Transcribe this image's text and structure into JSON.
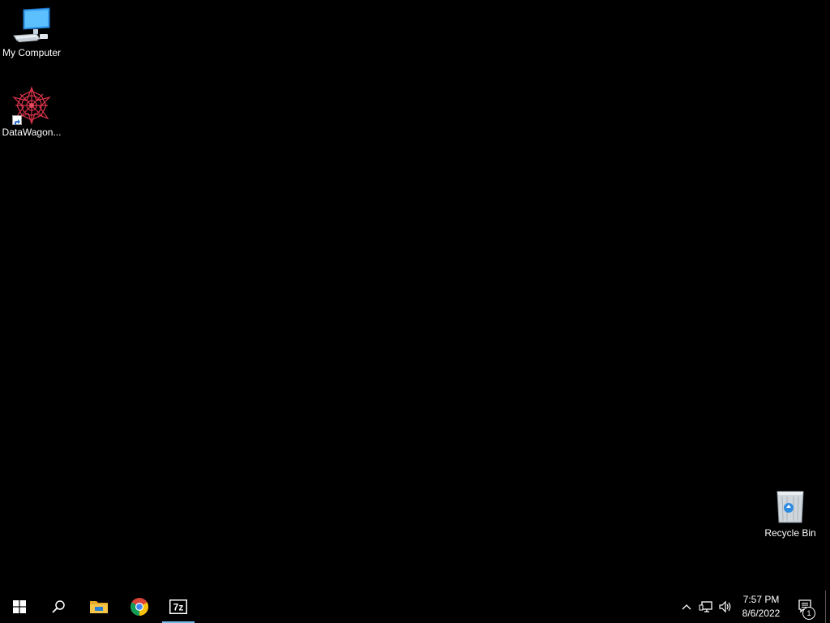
{
  "desktop": {
    "icons": [
      {
        "label": "My Computer",
        "icon": "computer-icon"
      },
      {
        "label": "DataWagon...",
        "icon": "datawagon-icon"
      },
      {
        "label": "Recycle Bin",
        "icon": "recycle-bin-icon"
      }
    ]
  },
  "taskbar": {
    "start": {
      "icon": "windows-logo-icon"
    },
    "search": {
      "icon": "search-icon"
    },
    "pinned": [
      {
        "name": "File Explorer",
        "icon": "folder-icon"
      },
      {
        "name": "Google Chrome",
        "icon": "chrome-icon"
      },
      {
        "name": "7-Zip",
        "icon": "7zip-icon",
        "icon_text": "7z",
        "active": true
      }
    ],
    "tray": {
      "icons": [
        "chevron-up-icon",
        "network-icon",
        "volume-icon"
      ],
      "time": "7:57 PM",
      "date": "8/6/2022",
      "notification_count": "1"
    }
  },
  "colors": {
    "desktop_background": "#000000",
    "taskbar_background": "#000000",
    "active_indicator": "#76b9ed"
  }
}
